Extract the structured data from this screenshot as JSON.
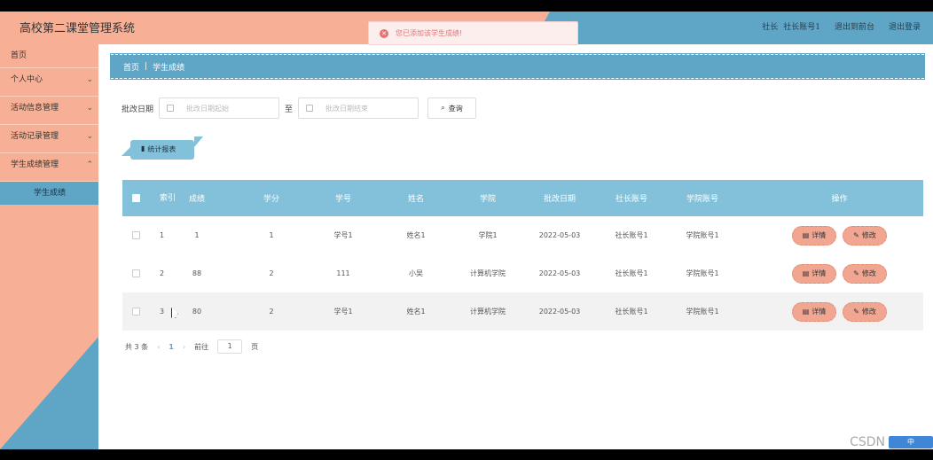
{
  "header": {
    "title": "高校第二课堂管理系统",
    "links": [
      "社长",
      "社长账号1",
      "退出到前台",
      "退出登录"
    ]
  },
  "toast": {
    "message": "您已添加该学生成绩!"
  },
  "sidebar": {
    "items": [
      {
        "label": "首页",
        "has_arrow": false
      },
      {
        "label": "个人中心",
        "has_arrow": true
      },
      {
        "label": "活动信息管理",
        "has_arrow": true
      },
      {
        "label": "活动记录管理",
        "has_arrow": true
      },
      {
        "label": "学生成绩管理",
        "has_arrow": true
      }
    ],
    "sub_item": "学生成绩"
  },
  "breadcrumb": {
    "home": "首页",
    "separator": "|",
    "current": "学生成绩"
  },
  "filter": {
    "label": "批改日期",
    "start_placeholder": "批改日期起始",
    "to": "至",
    "end_placeholder": "批改日期结束",
    "query_label": "查询"
  },
  "stat_button": {
    "label": "统计报表"
  },
  "table": {
    "headers": [
      "索引",
      "成绩",
      "学分",
      "学号",
      "姓名",
      "学院",
      "批改日期",
      "社长账号",
      "学院账号",
      "操作"
    ],
    "rows": [
      {
        "idx": "1",
        "score": "1",
        "credit": "1",
        "sno": "学号1",
        "name": "姓名1",
        "college": "学院1",
        "date": "2022-05-03",
        "leader": "社长账号1",
        "college_acct": "学院账号1"
      },
      {
        "idx": "2",
        "score": "88",
        "credit": "2",
        "sno": "111",
        "name": "小吴",
        "college": "计算机学院",
        "date": "2022-05-03",
        "leader": "社长账号1",
        "college_acct": "学院账号1"
      },
      {
        "idx": "3",
        "score": "80",
        "credit": "2",
        "sno": "学号1",
        "name": "姓名1",
        "college": "计算机学院",
        "date": "2022-05-03",
        "leader": "社长账号1",
        "college_acct": "学院账号1"
      }
    ],
    "detail_label": "详情",
    "edit_label": "修改"
  },
  "pager": {
    "total": "共 3 条",
    "prev": "‹",
    "current": "1",
    "next": "›",
    "goto": "前往",
    "goto_value": "1",
    "page_unit": "页"
  },
  "watermark": {
    "text": "CSDN",
    "badge": "中"
  }
}
